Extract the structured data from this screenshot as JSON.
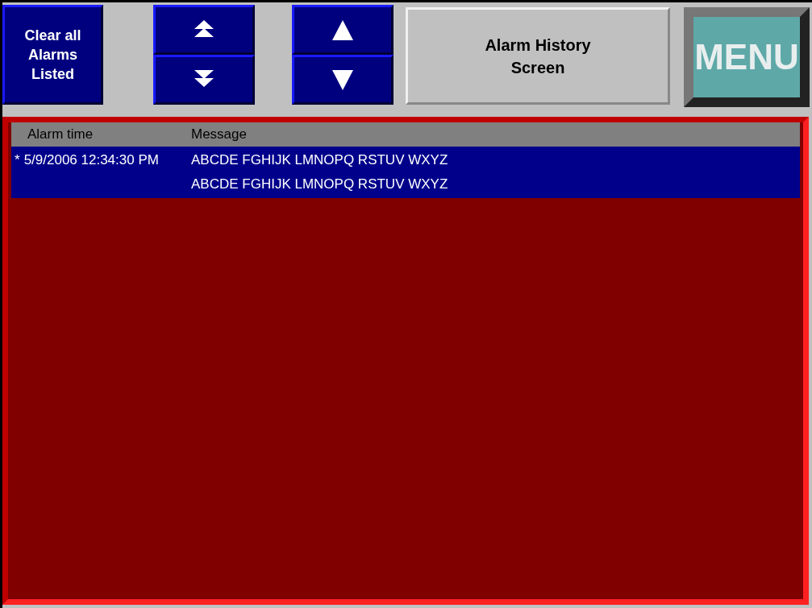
{
  "toolbar": {
    "clear_button": {
      "label": "Clear all Alarms Listed"
    },
    "page_buttons": [
      {
        "kind": "page-up"
      },
      {
        "kind": "page-down"
      }
    ],
    "line_buttons": [
      {
        "kind": "line-up"
      },
      {
        "kind": "line-down"
      }
    ],
    "title": "Alarm History Screen",
    "menu_button": {
      "label": "MENU"
    }
  },
  "table": {
    "columns": [
      "Alarm time",
      "Message"
    ],
    "rows": [
      {
        "selected": true,
        "marker": "*",
        "time": "5/9/2006 12:34:30 PM",
        "message_lines": [
          "ABCDE FGHIJK LMNOPQ RSTUV WXYZ",
          "ABCDE FGHIJK LMNOPQ RSTUV WXYZ"
        ]
      }
    ]
  }
}
